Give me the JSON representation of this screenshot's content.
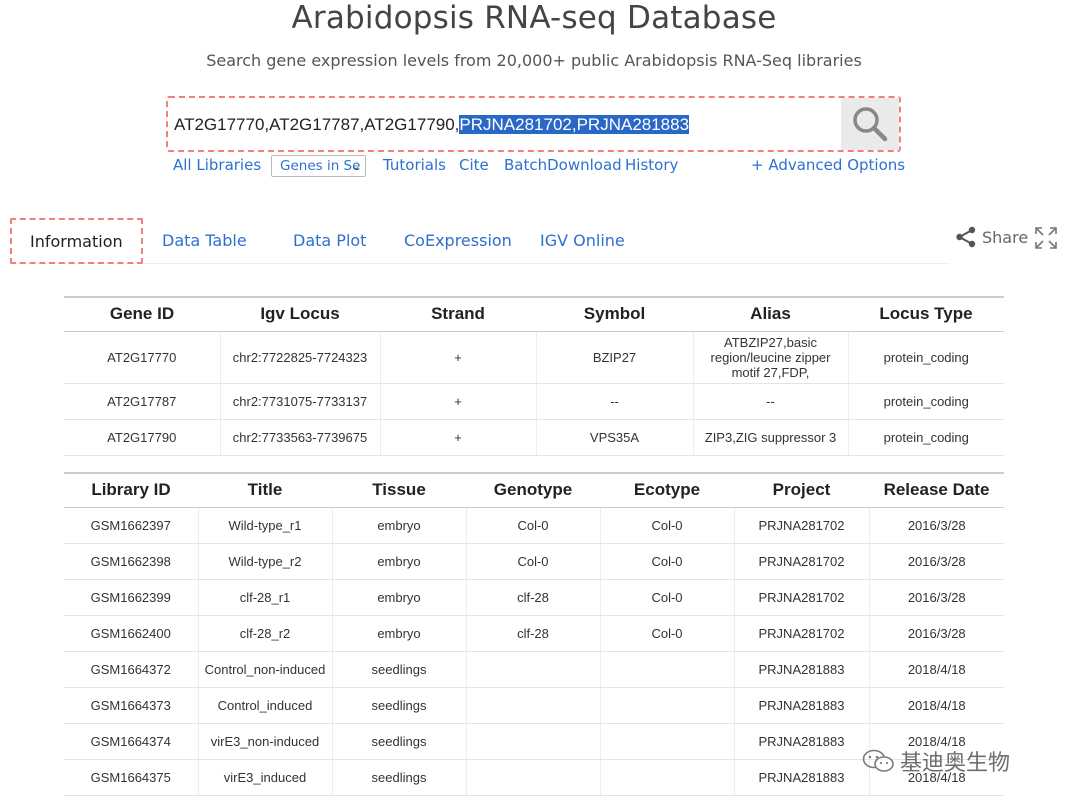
{
  "header": {
    "title": "Arabidopsis RNA-seq Database",
    "subtitle": "Search gene expression levels from 20,000+ public Arabidopsis RNA-Seq libraries"
  },
  "search": {
    "value_plain": "AT2G17770,AT2G17787,AT2G17790,",
    "value_selected": "PRJNA281702,PRJNA281883",
    "button_icon": "search-icon"
  },
  "links": {
    "all_libraries": "All Libraries",
    "genes_select": "Genes in Se",
    "tutorials": "Tutorials",
    "cite": "Cite",
    "batch_download": "BatchDownload",
    "history": "History",
    "advanced": "+ Advanced Options"
  },
  "tabs": {
    "information": "Information",
    "data_table": "Data Table",
    "data_plot": "Data Plot",
    "coexpression": "CoExpression",
    "igv_online": "IGV Online"
  },
  "share": {
    "label": "Share",
    "icon": "share-icon",
    "expand_icon": "expand-icon"
  },
  "gene_table": {
    "headers": [
      "Gene ID",
      "Igv Locus",
      "Strand",
      "Symbol",
      "Alias",
      "Locus Type"
    ],
    "rows": [
      [
        "AT2G17770",
        "chr2:7722825-7724323",
        "+",
        "BZIP27",
        "ATBZIP27,basic region/leucine zipper motif 27,FDP,",
        "protein_coding"
      ],
      [
        "AT2G17787",
        "chr2:7731075-7733137",
        "+",
        "--",
        "--",
        "protein_coding"
      ],
      [
        "AT2G17790",
        "chr2:7733563-7739675",
        "+",
        "VPS35A",
        "ZIP3,ZIG suppressor 3",
        "protein_coding"
      ]
    ]
  },
  "library_table": {
    "headers": [
      "Library ID",
      "Title",
      "Tissue",
      "Genotype",
      "Ecotype",
      "Project",
      "Release Date"
    ],
    "rows": [
      [
        "GSM1662397",
        "Wild-type_r1",
        "embryo",
        "Col-0",
        "Col-0",
        "PRJNA281702",
        "2016/3/28"
      ],
      [
        "GSM1662398",
        "Wild-type_r2",
        "embryo",
        "Col-0",
        "Col-0",
        "PRJNA281702",
        "2016/3/28"
      ],
      [
        "GSM1662399",
        "clf-28_r1",
        "embryo",
        "clf-28",
        "Col-0",
        "PRJNA281702",
        "2016/3/28"
      ],
      [
        "GSM1662400",
        "clf-28_r2",
        "embryo",
        "clf-28",
        "Col-0",
        "PRJNA281702",
        "2016/3/28"
      ],
      [
        "GSM1664372",
        "Control_non-induced",
        "seedlings",
        "",
        "",
        "PRJNA281883",
        "2018/4/18"
      ],
      [
        "GSM1664373",
        "Control_induced",
        "seedlings",
        "",
        "",
        "PRJNA281883",
        "2018/4/18"
      ],
      [
        "GSM1664374",
        "virE3_non-induced",
        "seedlings",
        "",
        "",
        "PRJNA281883",
        "2018/4/18"
      ],
      [
        "GSM1664375",
        "virE3_induced",
        "seedlings",
        "",
        "",
        "PRJNA281883",
        "2018/4/18"
      ]
    ]
  },
  "watermark": {
    "text": "基迪奥生物",
    "icon": "wechat-icon"
  },
  "colors": {
    "link": "#2f6fd0",
    "selection": "#2a68c8",
    "highlight_border": "#f08080"
  }
}
